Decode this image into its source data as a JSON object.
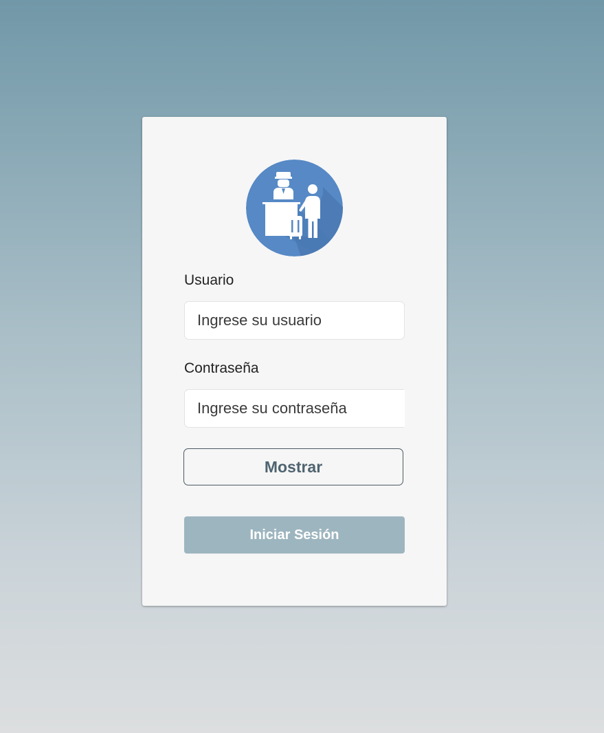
{
  "login": {
    "logo_icon": "hotel-reception-icon",
    "username_label": "Usuario",
    "username_placeholder": "Ingrese su usuario",
    "password_label": "Contraseña",
    "password_placeholder": "Ingrese su contraseña",
    "show_button_label": "Mostrar",
    "submit_button_label": "Iniciar Sesión"
  },
  "colors": {
    "logo_circle": "#5689c5",
    "submit_button": "#9db5bf",
    "card_background": "#f6f6f6"
  }
}
